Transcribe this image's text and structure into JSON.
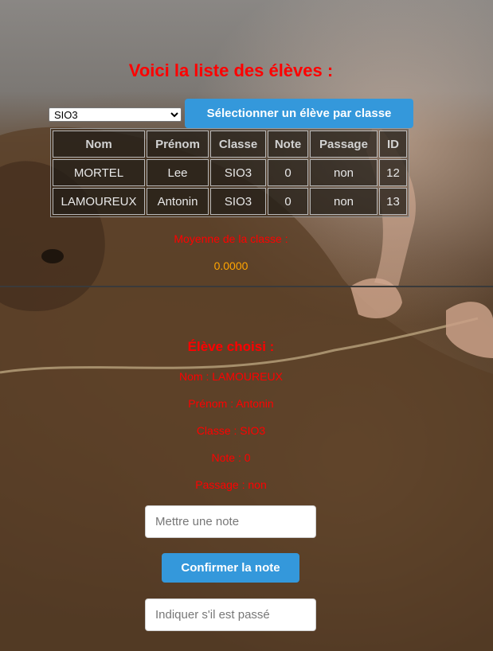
{
  "title": "Voici la liste des élèves :",
  "class_select": {
    "selected": "SIO3"
  },
  "buttons": {
    "select_by_class": "Sélectionner un élève par classe",
    "confirm_note": "Confirmer la note"
  },
  "table": {
    "headers": [
      "Nom",
      "Prénom",
      "Classe",
      "Note",
      "Passage",
      "ID"
    ],
    "rows": [
      [
        "MORTEL",
        "Lee",
        "SIO3",
        "0",
        "non",
        "12"
      ],
      [
        "LAMOUREUX",
        "Antonin",
        "SIO3",
        "0",
        "non",
        "13"
      ]
    ]
  },
  "average": {
    "label": "Moyenne de la classe :",
    "value": "0.0000"
  },
  "chosen": {
    "title": "Élève choisi :",
    "nom": "Nom : LAMOUREUX",
    "prenom": "Prénom : Antonin",
    "classe": "Classe : SIO3",
    "note": "Note : 0",
    "passage": "Passage : non"
  },
  "inputs": {
    "note_placeholder": "Mettre une note",
    "passage_placeholder": "Indiquer s'il est passé"
  },
  "colors": {
    "accent": "#3498db",
    "text_red": "#ff0000",
    "average_orange": "#ffa500"
  }
}
